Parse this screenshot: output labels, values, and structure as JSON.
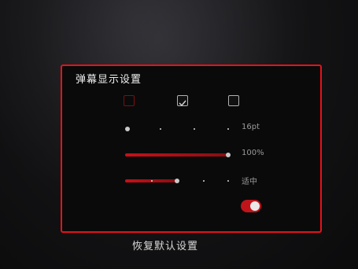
{
  "panel": {
    "title": "弹幕显示设置",
    "accent_color": "#e5121b",
    "position_options": [
      {
        "label": "",
        "checked": false
      },
      {
        "label": "",
        "checked": true
      },
      {
        "label": "",
        "checked": true
      }
    ],
    "font_size": {
      "value_text": "16pt",
      "level": 0.0,
      "ticks": 4
    },
    "opacity": {
      "value_text": "100%",
      "level": 1.0
    },
    "speed": {
      "value_text": "适中",
      "level": 0.5,
      "ticks": 5
    },
    "toggle": {
      "on": true
    }
  },
  "reset_label": "恢复默认设置"
}
